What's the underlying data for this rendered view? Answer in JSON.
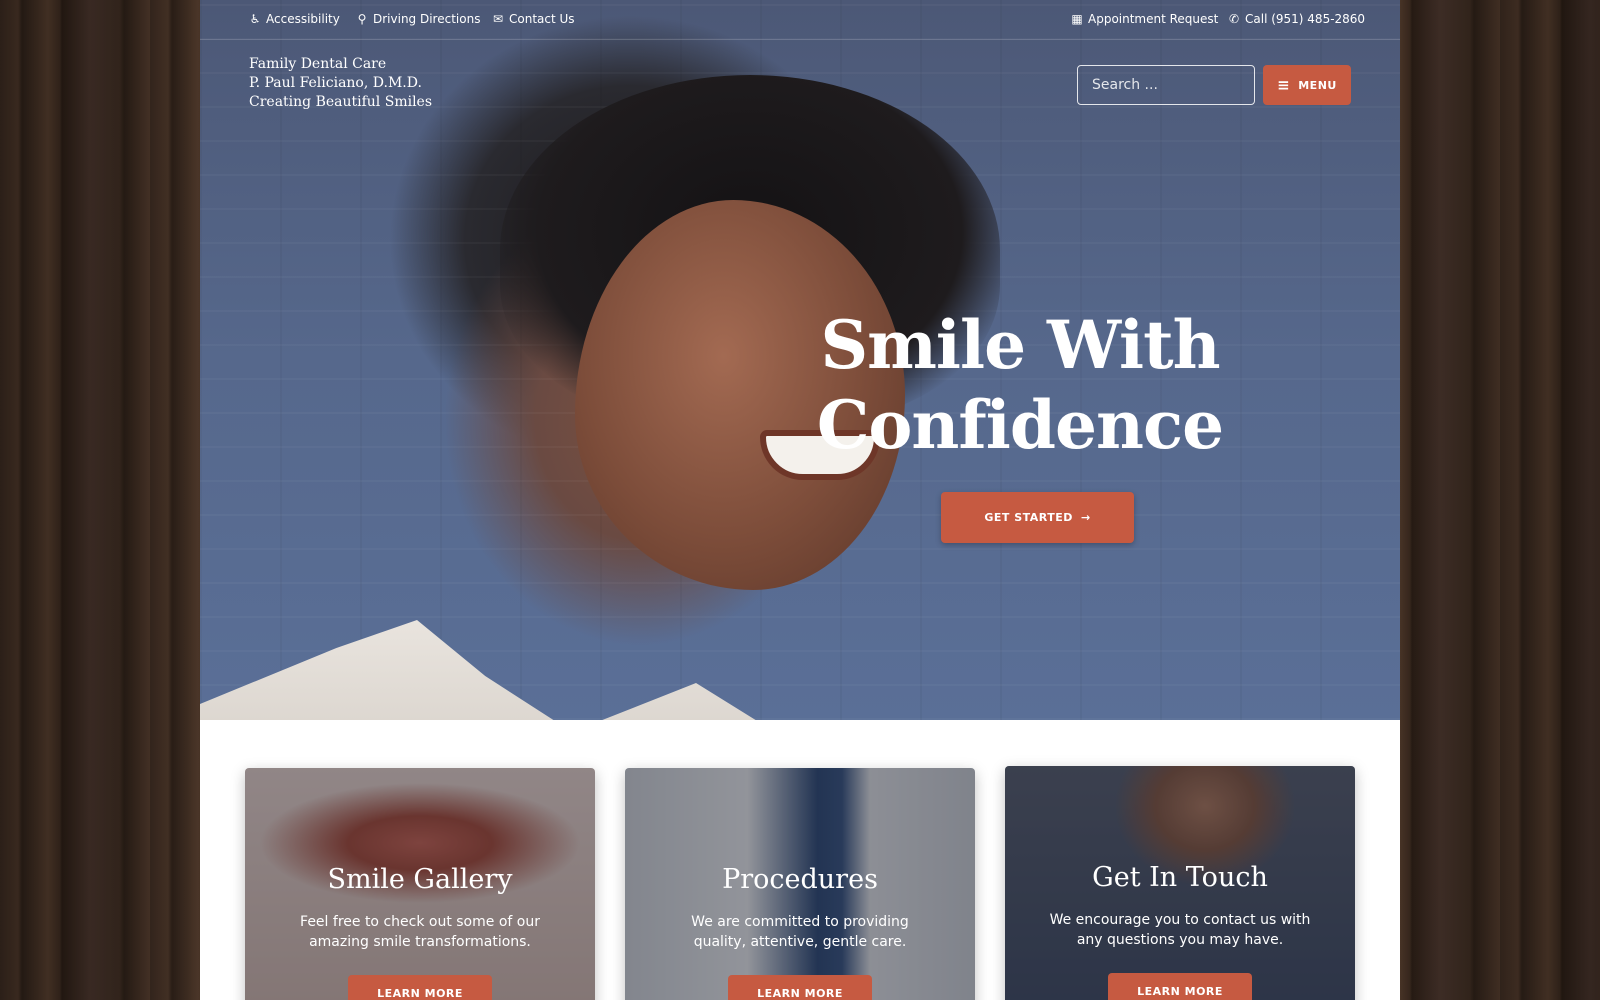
{
  "topbar": {
    "left": [
      {
        "icon": "wheelchair-icon",
        "glyph": "♿",
        "label": "Accessibility"
      },
      {
        "icon": "map-marker-icon",
        "glyph": "⚲",
        "label": "Driving Directions"
      },
      {
        "icon": "envelope-icon",
        "glyph": "✉",
        "label": "Contact Us"
      }
    ],
    "right": [
      {
        "icon": "calendar-icon",
        "glyph": "▦",
        "label": "Appointment Request"
      },
      {
        "icon": "phone-icon",
        "glyph": "✆",
        "label": "Call (951) 485-2860"
      }
    ]
  },
  "logo": {
    "line1": "Family Dental Care",
    "line2": "P. Paul Feliciano, D.M.D.",
    "line3": "Creating Beautiful Smiles"
  },
  "search": {
    "placeholder": "Search ...",
    "icon": "search-icon",
    "glyph": "⚲"
  },
  "menu": {
    "icon": "hamburger-icon",
    "glyph": "≡",
    "label": "MENU"
  },
  "hero": {
    "headline_line1": "Smile With",
    "headline_line2": "Confidence",
    "cta_label": "GET STARTED",
    "cta_icon": "arrow-right-icon",
    "cta_glyph": "→"
  },
  "cards": [
    {
      "title": "Smile Gallery",
      "text": "Feel free to check out some of our amazing smile transformations.",
      "button": "LEARN MORE"
    },
    {
      "title": "Procedures",
      "text": "We are committed to providing quality, attentive, gentle care.",
      "button": "LEARN MORE"
    },
    {
      "title": "Get In Touch",
      "text": "We encourage you to contact us with any questions you may have.",
      "button": "LEARN MORE"
    }
  ],
  "colors": {
    "accent": "#c65a41",
    "hero_overlay": "#56688c",
    "text_light": "#ffffff"
  }
}
